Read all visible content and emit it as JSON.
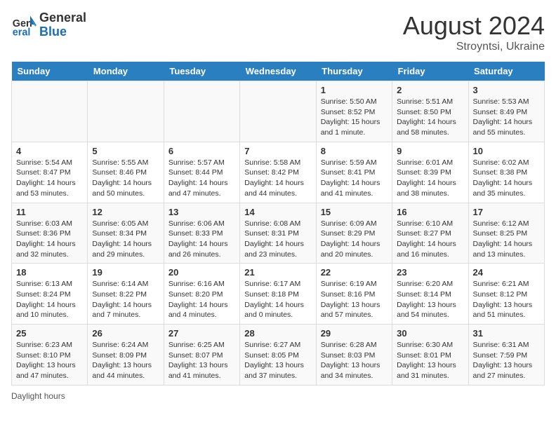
{
  "header": {
    "logo_general": "General",
    "logo_blue": "Blue",
    "month_title": "August 2024",
    "location": "Stroyntsi, Ukraine"
  },
  "footer": {
    "daylight_label": "Daylight hours"
  },
  "calendar": {
    "days_of_week": [
      "Sunday",
      "Monday",
      "Tuesday",
      "Wednesday",
      "Thursday",
      "Friday",
      "Saturday"
    ],
    "weeks": [
      [
        {
          "day": "",
          "info": ""
        },
        {
          "day": "",
          "info": ""
        },
        {
          "day": "",
          "info": ""
        },
        {
          "day": "",
          "info": ""
        },
        {
          "day": "1",
          "info": "Sunrise: 5:50 AM\nSunset: 8:52 PM\nDaylight: 15 hours\nand 1 minute."
        },
        {
          "day": "2",
          "info": "Sunrise: 5:51 AM\nSunset: 8:50 PM\nDaylight: 14 hours\nand 58 minutes."
        },
        {
          "day": "3",
          "info": "Sunrise: 5:53 AM\nSunset: 8:49 PM\nDaylight: 14 hours\nand 55 minutes."
        }
      ],
      [
        {
          "day": "4",
          "info": "Sunrise: 5:54 AM\nSunset: 8:47 PM\nDaylight: 14 hours\nand 53 minutes."
        },
        {
          "day": "5",
          "info": "Sunrise: 5:55 AM\nSunset: 8:46 PM\nDaylight: 14 hours\nand 50 minutes."
        },
        {
          "day": "6",
          "info": "Sunrise: 5:57 AM\nSunset: 8:44 PM\nDaylight: 14 hours\nand 47 minutes."
        },
        {
          "day": "7",
          "info": "Sunrise: 5:58 AM\nSunset: 8:42 PM\nDaylight: 14 hours\nand 44 minutes."
        },
        {
          "day": "8",
          "info": "Sunrise: 5:59 AM\nSunset: 8:41 PM\nDaylight: 14 hours\nand 41 minutes."
        },
        {
          "day": "9",
          "info": "Sunrise: 6:01 AM\nSunset: 8:39 PM\nDaylight: 14 hours\nand 38 minutes."
        },
        {
          "day": "10",
          "info": "Sunrise: 6:02 AM\nSunset: 8:38 PM\nDaylight: 14 hours\nand 35 minutes."
        }
      ],
      [
        {
          "day": "11",
          "info": "Sunrise: 6:03 AM\nSunset: 8:36 PM\nDaylight: 14 hours\nand 32 minutes."
        },
        {
          "day": "12",
          "info": "Sunrise: 6:05 AM\nSunset: 8:34 PM\nDaylight: 14 hours\nand 29 minutes."
        },
        {
          "day": "13",
          "info": "Sunrise: 6:06 AM\nSunset: 8:33 PM\nDaylight: 14 hours\nand 26 minutes."
        },
        {
          "day": "14",
          "info": "Sunrise: 6:08 AM\nSunset: 8:31 PM\nDaylight: 14 hours\nand 23 minutes."
        },
        {
          "day": "15",
          "info": "Sunrise: 6:09 AM\nSunset: 8:29 PM\nDaylight: 14 hours\nand 20 minutes."
        },
        {
          "day": "16",
          "info": "Sunrise: 6:10 AM\nSunset: 8:27 PM\nDaylight: 14 hours\nand 16 minutes."
        },
        {
          "day": "17",
          "info": "Sunrise: 6:12 AM\nSunset: 8:25 PM\nDaylight: 14 hours\nand 13 minutes."
        }
      ],
      [
        {
          "day": "18",
          "info": "Sunrise: 6:13 AM\nSunset: 8:24 PM\nDaylight: 14 hours\nand 10 minutes."
        },
        {
          "day": "19",
          "info": "Sunrise: 6:14 AM\nSunset: 8:22 PM\nDaylight: 14 hours\nand 7 minutes."
        },
        {
          "day": "20",
          "info": "Sunrise: 6:16 AM\nSunset: 8:20 PM\nDaylight: 14 hours\nand 4 minutes."
        },
        {
          "day": "21",
          "info": "Sunrise: 6:17 AM\nSunset: 8:18 PM\nDaylight: 14 hours\nand 0 minutes."
        },
        {
          "day": "22",
          "info": "Sunrise: 6:19 AM\nSunset: 8:16 PM\nDaylight: 13 hours\nand 57 minutes."
        },
        {
          "day": "23",
          "info": "Sunrise: 6:20 AM\nSunset: 8:14 PM\nDaylight: 13 hours\nand 54 minutes."
        },
        {
          "day": "24",
          "info": "Sunrise: 6:21 AM\nSunset: 8:12 PM\nDaylight: 13 hours\nand 51 minutes."
        }
      ],
      [
        {
          "day": "25",
          "info": "Sunrise: 6:23 AM\nSunset: 8:10 PM\nDaylight: 13 hours\nand 47 minutes."
        },
        {
          "day": "26",
          "info": "Sunrise: 6:24 AM\nSunset: 8:09 PM\nDaylight: 13 hours\nand 44 minutes."
        },
        {
          "day": "27",
          "info": "Sunrise: 6:25 AM\nSunset: 8:07 PM\nDaylight: 13 hours\nand 41 minutes."
        },
        {
          "day": "28",
          "info": "Sunrise: 6:27 AM\nSunset: 8:05 PM\nDaylight: 13 hours\nand 37 minutes."
        },
        {
          "day": "29",
          "info": "Sunrise: 6:28 AM\nSunset: 8:03 PM\nDaylight: 13 hours\nand 34 minutes."
        },
        {
          "day": "30",
          "info": "Sunrise: 6:30 AM\nSunset: 8:01 PM\nDaylight: 13 hours\nand 31 minutes."
        },
        {
          "day": "31",
          "info": "Sunrise: 6:31 AM\nSunset: 7:59 PM\nDaylight: 13 hours\nand 27 minutes."
        }
      ]
    ]
  }
}
